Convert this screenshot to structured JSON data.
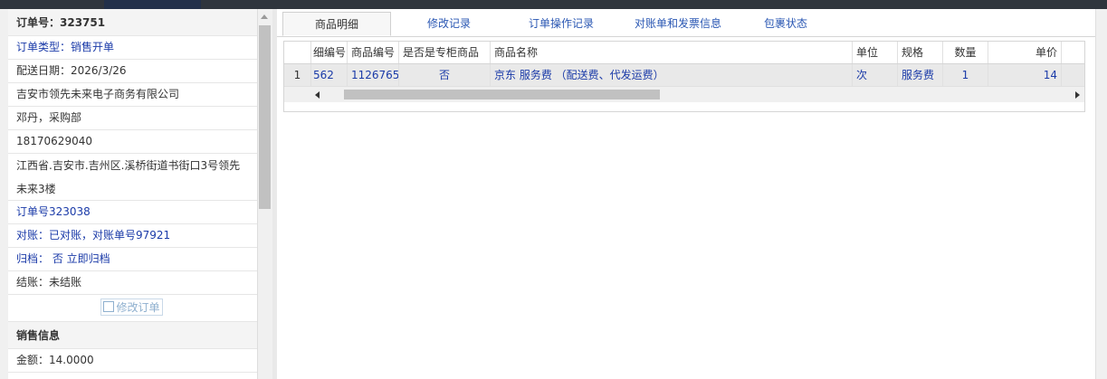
{
  "order": {
    "title": "订单号：323751",
    "type": "订单类型：销售开单",
    "delivery_date": "配送日期：2026/3/26",
    "company": "吉安市领先未来电子商务有限公司",
    "contact": "邓丹，采购部",
    "phone": "18170629040",
    "address": "江西省.吉安市.吉州区.溪桥街道书街口3号领先未来3楼",
    "order_no": "订单号323038",
    "reconcile": "对账：已对账，对账单号97921",
    "archive": "归档： 否 立即归档",
    "settle": "结账：未结账",
    "edit_button": "修改订单"
  },
  "sales": {
    "title": "销售信息",
    "amount": "金额：14.0000"
  },
  "tabs": [
    "商品明细",
    "修改记录",
    "订单操作记录",
    "对账单和发票信息",
    "包裹状态"
  ],
  "grid": {
    "columns": [
      "细编号",
      "商品编号",
      "是否是专柜商品",
      "商品名称",
      "单位",
      "规格",
      "数量",
      "单价"
    ],
    "rows": [
      {
        "index": "1",
        "detail_no": "562",
        "product_no": "1126765",
        "counter": "否",
        "name": "京东 服务费 （配送费、代发运费）",
        "unit": "次",
        "spec": "服务费",
        "qty": "1",
        "price": "14"
      }
    ]
  },
  "colors": {
    "link_blue": "#1a3aa8",
    "tab_blue": "#2a57b3",
    "topbar": "#2f353d"
  }
}
